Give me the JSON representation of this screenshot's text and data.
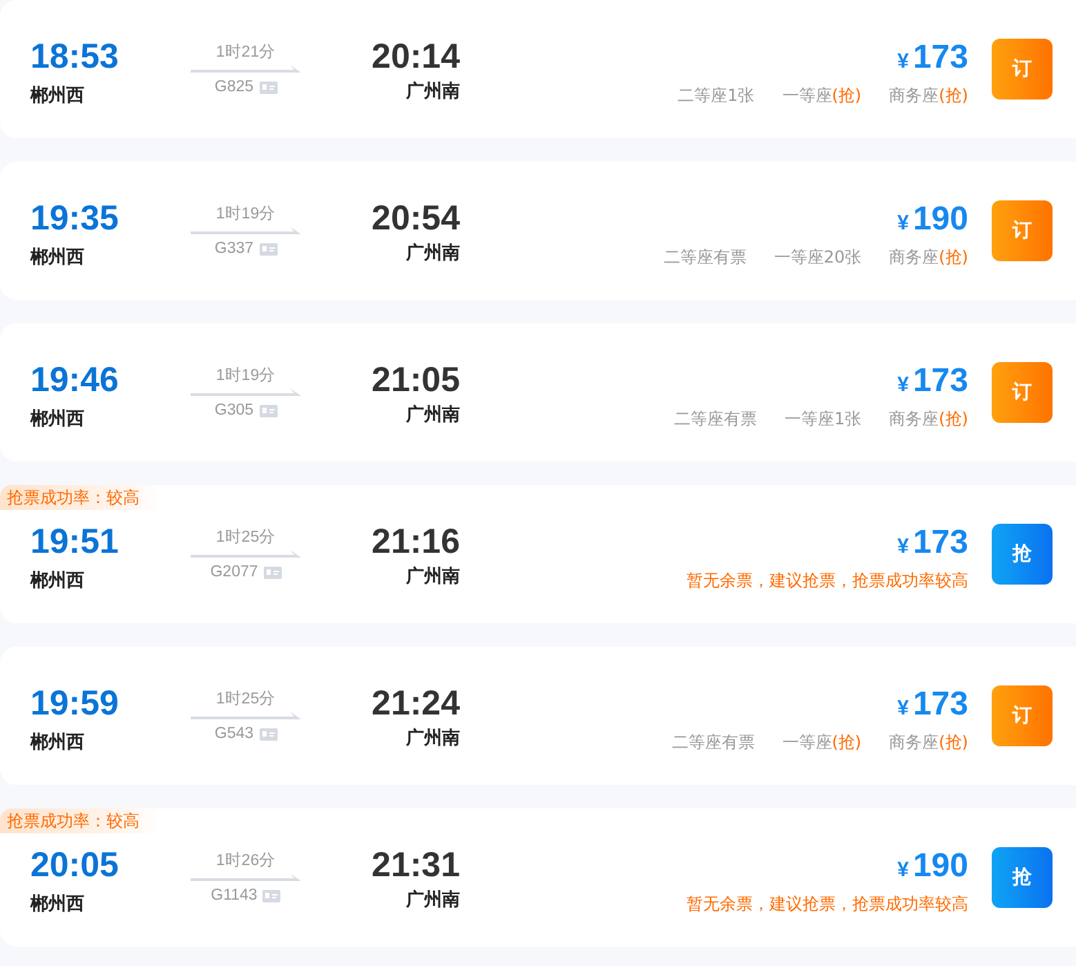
{
  "trains": [
    {
      "depart_time": "18:53",
      "depart_station": "郴州西",
      "duration": "1时21分",
      "train_no": "G825",
      "arrive_time": "20:14",
      "arrive_station": "广州南",
      "currency": "¥",
      "price": "173",
      "seats": [
        {
          "kind": "seat",
          "name": "二等座",
          "status": "1张"
        },
        {
          "kind": "seat",
          "name": "一等座",
          "status": "(抢)"
        },
        {
          "kind": "seat",
          "name": "商务座",
          "status": "(抢)"
        }
      ],
      "button": {
        "kind": "book",
        "label": "订"
      }
    },
    {
      "depart_time": "19:35",
      "depart_station": "郴州西",
      "duration": "1时19分",
      "train_no": "G337",
      "arrive_time": "20:54",
      "arrive_station": "广州南",
      "currency": "¥",
      "price": "190",
      "seats": [
        {
          "kind": "seat",
          "name": "二等座",
          "status": "有票"
        },
        {
          "kind": "seat",
          "name": "一等座",
          "status": "20张"
        },
        {
          "kind": "seat",
          "name": "商务座",
          "status": "(抢)"
        }
      ],
      "button": {
        "kind": "book",
        "label": "订"
      }
    },
    {
      "depart_time": "19:46",
      "depart_station": "郴州西",
      "duration": "1时19分",
      "train_no": "G305",
      "arrive_time": "21:05",
      "arrive_station": "广州南",
      "currency": "¥",
      "price": "173",
      "seats": [
        {
          "kind": "seat",
          "name": "二等座",
          "status": "有票"
        },
        {
          "kind": "seat",
          "name": "一等座",
          "status": "1张"
        },
        {
          "kind": "seat",
          "name": "商务座",
          "status": "(抢)"
        }
      ],
      "button": {
        "kind": "book",
        "label": "订"
      }
    },
    {
      "tag": "抢票成功率：较高",
      "depart_time": "19:51",
      "depart_station": "郴州西",
      "duration": "1时25分",
      "train_no": "G2077",
      "arrive_time": "21:16",
      "arrive_station": "广州南",
      "currency": "¥",
      "price": "173",
      "seats": [
        {
          "kind": "notice",
          "text": "暂无余票，建议抢票，抢票成功率较高"
        }
      ],
      "button": {
        "kind": "grab",
        "label": "抢"
      }
    },
    {
      "depart_time": "19:59",
      "depart_station": "郴州西",
      "duration": "1时25分",
      "train_no": "G543",
      "arrive_time": "21:24",
      "arrive_station": "广州南",
      "currency": "¥",
      "price": "173",
      "seats": [
        {
          "kind": "seat",
          "name": "二等座",
          "status": "有票"
        },
        {
          "kind": "seat",
          "name": "一等座",
          "status": "(抢)"
        },
        {
          "kind": "seat",
          "name": "商务座",
          "status": "(抢)"
        }
      ],
      "button": {
        "kind": "book",
        "label": "订"
      }
    },
    {
      "tag": "抢票成功率：较高",
      "depart_time": "20:05",
      "depart_station": "郴州西",
      "duration": "1时26分",
      "train_no": "G1143",
      "arrive_time": "21:31",
      "arrive_station": "广州南",
      "currency": "¥",
      "price": "190",
      "seats": [
        {
          "kind": "notice",
          "text": "暂无余票，建议抢票，抢票成功率较高"
        }
      ],
      "button": {
        "kind": "grab",
        "label": "抢"
      }
    }
  ]
}
